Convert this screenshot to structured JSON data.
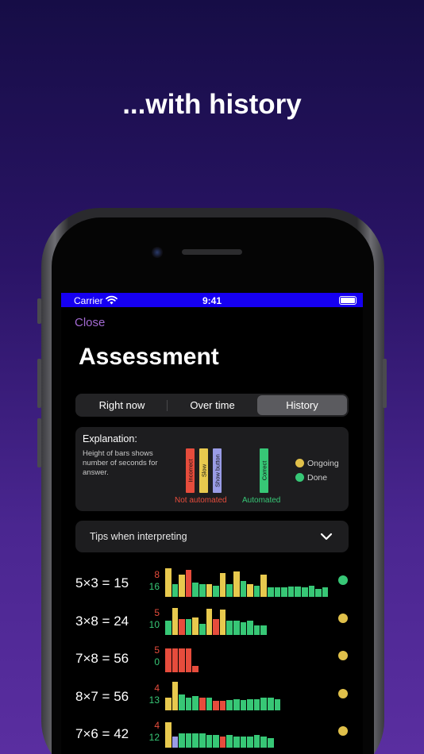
{
  "headline": "...with history",
  "status_bar": {
    "carrier": "Carrier",
    "time": "9:41"
  },
  "nav": {
    "close_label": "Close"
  },
  "title": "Assessment",
  "tabs": [
    {
      "label": "Right now",
      "active": false
    },
    {
      "label": "Over time",
      "active": false
    },
    {
      "label": "History",
      "active": true
    }
  ],
  "explanation": {
    "title": "Explanation:",
    "description": "Height of bars shows number of seconds for answer.",
    "legend_bars": [
      {
        "label": "Incorrect",
        "color": "#e64c3c"
      },
      {
        "label": "Slow",
        "color": "#e8c94e"
      },
      {
        "label": "Show button",
        "color": "#9a9ce6"
      },
      {
        "label": "Correct",
        "color": "#37c776"
      }
    ],
    "not_automated_label": "Not automated",
    "automated_label": "Automated",
    "status_legend": [
      {
        "label": "Ongoing",
        "color": "#e0c04a"
      },
      {
        "label": "Done",
        "color": "#37c776"
      }
    ]
  },
  "tips": {
    "label": "Tips when interpreting",
    "icon": "chevron-down-icon"
  },
  "colors": {
    "incorrect": "#e64c3c",
    "slow": "#e8c94e",
    "show": "#9a9ce6",
    "correct": "#37c776",
    "ongoing": "#e0c04a",
    "done": "#37c776"
  },
  "facts": [
    {
      "equation": "5×3 = 15",
      "not_automated": "8",
      "automated": "16",
      "status": "done",
      "history": [
        {
          "r": "slow",
          "h": 36
        },
        {
          "r": "correct",
          "h": 16
        },
        {
          "r": "slow",
          "h": 28
        },
        {
          "r": "incorrect",
          "h": 34
        },
        {
          "r": "correct",
          "h": 18
        },
        {
          "r": "correct",
          "h": 16
        },
        {
          "r": "slow",
          "h": 16
        },
        {
          "r": "correct",
          "h": 14
        },
        {
          "r": "slow",
          "h": 30
        },
        {
          "r": "correct",
          "h": 16
        },
        {
          "r": "slow",
          "h": 32
        },
        {
          "r": "correct",
          "h": 20
        },
        {
          "r": "slow",
          "h": 16
        },
        {
          "r": "correct",
          "h": 14
        },
        {
          "r": "slow",
          "h": 28
        },
        {
          "r": "correct",
          "h": 12
        },
        {
          "r": "correct",
          "h": 12
        },
        {
          "r": "correct",
          "h": 12
        },
        {
          "r": "correct",
          "h": 13
        },
        {
          "r": "correct",
          "h": 13
        },
        {
          "r": "correct",
          "h": 12
        },
        {
          "r": "correct",
          "h": 14
        },
        {
          "r": "correct",
          "h": 10
        },
        {
          "r": "correct",
          "h": 12
        }
      ]
    },
    {
      "equation": "3×8 = 24",
      "not_automated": "5",
      "automated": "10",
      "status": "ongoing",
      "history": [
        {
          "r": "correct",
          "h": 18
        },
        {
          "r": "slow",
          "h": 34
        },
        {
          "r": "incorrect",
          "h": 20
        },
        {
          "r": "correct",
          "h": 20
        },
        {
          "r": "slow",
          "h": 22
        },
        {
          "r": "correct",
          "h": 14
        },
        {
          "r": "slow",
          "h": 33
        },
        {
          "r": "incorrect",
          "h": 20
        },
        {
          "r": "slow",
          "h": 32
        },
        {
          "r": "correct",
          "h": 18
        },
        {
          "r": "correct",
          "h": 18
        },
        {
          "r": "correct",
          "h": 16
        },
        {
          "r": "correct",
          "h": 18
        },
        {
          "r": "correct",
          "h": 12
        },
        {
          "r": "correct",
          "h": 12
        }
      ]
    },
    {
      "equation": "7×8 = 56",
      "not_automated": "5",
      "automated": "0",
      "status": "ongoing",
      "history": [
        {
          "r": "incorrect",
          "h": 30
        },
        {
          "r": "incorrect",
          "h": 30
        },
        {
          "r": "incorrect",
          "h": 30
        },
        {
          "r": "incorrect",
          "h": 30
        },
        {
          "r": "incorrect",
          "h": 8
        }
      ]
    },
    {
      "equation": "8×7 = 56",
      "not_automated": "4",
      "automated": "13",
      "status": "ongoing",
      "history": [
        {
          "r": "slow",
          "h": 16
        },
        {
          "r": "slow",
          "h": 36
        },
        {
          "r": "correct",
          "h": 20
        },
        {
          "r": "correct",
          "h": 16
        },
        {
          "r": "correct",
          "h": 18
        },
        {
          "r": "incorrect",
          "h": 16
        },
        {
          "r": "correct",
          "h": 16
        },
        {
          "r": "incorrect",
          "h": 12
        },
        {
          "r": "incorrect",
          "h": 12
        },
        {
          "r": "correct",
          "h": 13
        },
        {
          "r": "correct",
          "h": 14
        },
        {
          "r": "correct",
          "h": 13
        },
        {
          "r": "correct",
          "h": 14
        },
        {
          "r": "correct",
          "h": 14
        },
        {
          "r": "correct",
          "h": 16
        },
        {
          "r": "correct",
          "h": 16
        },
        {
          "r": "correct",
          "h": 14
        }
      ]
    },
    {
      "equation": "7×6 = 42",
      "not_automated": "4",
      "automated": "12",
      "status": "ongoing",
      "history": [
        {
          "r": "slow",
          "h": 32
        },
        {
          "r": "show",
          "h": 14
        },
        {
          "r": "correct",
          "h": 18
        },
        {
          "r": "correct",
          "h": 18
        },
        {
          "r": "correct",
          "h": 18
        },
        {
          "r": "correct",
          "h": 18
        },
        {
          "r": "correct",
          "h": 16
        },
        {
          "r": "correct",
          "h": 16
        },
        {
          "r": "incorrect",
          "h": 14
        },
        {
          "r": "correct",
          "h": 16
        },
        {
          "r": "correct",
          "h": 14
        },
        {
          "r": "correct",
          "h": 14
        },
        {
          "r": "correct",
          "h": 14
        },
        {
          "r": "correct",
          "h": 16
        },
        {
          "r": "correct",
          "h": 14
        },
        {
          "r": "correct",
          "h": 12
        }
      ]
    }
  ]
}
